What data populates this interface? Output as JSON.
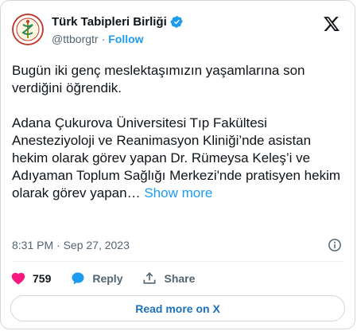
{
  "account": {
    "name": "Türk Tabipleri Birliği",
    "handle": "@ttborgtr",
    "separator": "·",
    "follow_label": "Follow",
    "avatar_icon": "ttb-logo",
    "verified_icon": "verified-badge-icon"
  },
  "tweet": {
    "paragraph1": "Bugün iki genç meslektaşımızın yaşamlarına son verdiğini öğrendik.",
    "paragraph2": "Adana Çukurova Üniversitesi Tıp Fakültesi Anesteziyoloji ve Reanimasyon Kliniği’nde asistan hekim olarak görev yapan Dr. Rümeysa Keleş’i ve Adıyaman Toplum Sağlığı Merkezi'nde pratisyen hekim olarak görev yapan…",
    "show_more": "Show more",
    "timestamp": "8:31 PM · Sep 27, 2023"
  },
  "actions": {
    "like_count": "759",
    "reply_label": "Reply",
    "share_label": "Share"
  },
  "read_more_label": "Read more on X",
  "colors": {
    "accent": "#1d9bf0",
    "like": "#f91880",
    "text": "#0f1419",
    "muted": "#536471",
    "border": "#cfd9de"
  }
}
